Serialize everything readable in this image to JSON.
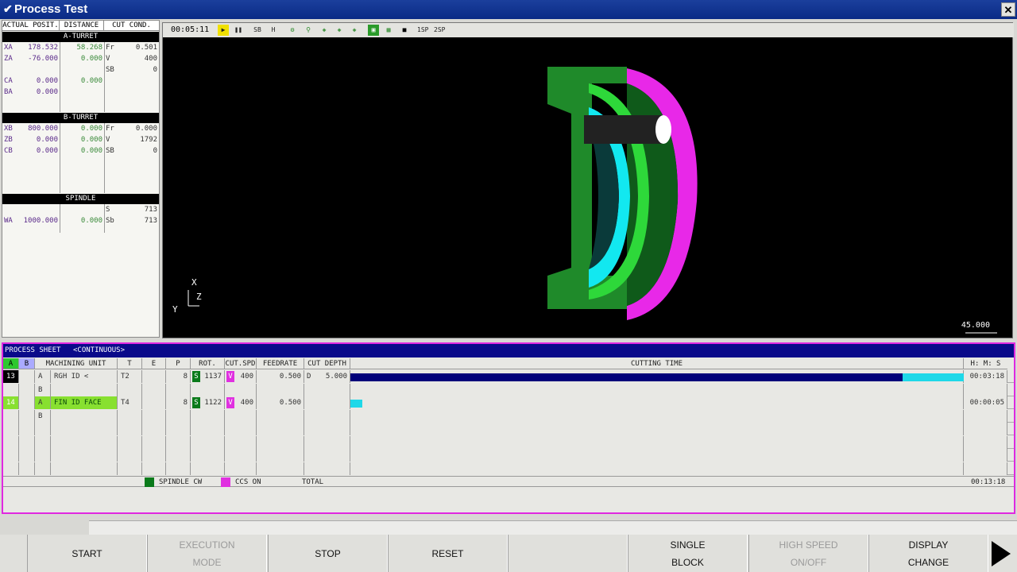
{
  "window": {
    "title": "Process Test",
    "close_label": "✕"
  },
  "left_panel": {
    "headers": [
      "ACTUAL POSIT.",
      "DISTANCE",
      "CUT COND."
    ],
    "a_turret": {
      "title": "A-TURRET",
      "rows": [
        {
          "axis": "XA",
          "pos": "178.532",
          "dist": "58.268",
          "cond": "Fr",
          "val": "0.501"
        },
        {
          "axis": "ZA",
          "pos": "-76.000",
          "dist": "0.000",
          "cond": "V",
          "val": "400"
        },
        {
          "axis": "",
          "pos": "",
          "dist": "",
          "cond": "SB",
          "val": "0"
        },
        {
          "axis": "CA",
          "pos": "0.000",
          "dist": "0.000",
          "cond": "",
          "val": ""
        },
        {
          "axis": "BA",
          "pos": "0.000",
          "dist": "",
          "cond": "",
          "val": ""
        }
      ]
    },
    "b_turret": {
      "title": "B-TURRET",
      "rows": [
        {
          "axis": "XB",
          "pos": "800.000",
          "dist": "0.000",
          "cond": "Fr",
          "val": "0.000"
        },
        {
          "axis": "ZB",
          "pos": "0.000",
          "dist": "0.000",
          "cond": "V",
          "val": "1792"
        },
        {
          "axis": "CB",
          "pos": "0.000",
          "dist": "0.000",
          "cond": "SB",
          "val": "0"
        }
      ]
    },
    "spindle": {
      "title": "SPINDLE",
      "rows": [
        {
          "axis": "",
          "pos": "",
          "dist": "",
          "cond": "S",
          "val": "713"
        },
        {
          "axis": "WA",
          "pos": "1000.000",
          "dist": "0.000",
          "cond": "Sb",
          "val": "713"
        }
      ]
    }
  },
  "graphic": {
    "time": "00:05:11",
    "scale": "45.000",
    "axis_x": "X",
    "axis_y": "Y",
    "axis_z": "Z",
    "toolbar": [
      "play-icon",
      "pause-icon",
      "sb-icon",
      "h-icon",
      "tool-icon",
      "probe-icon",
      "cube-icon",
      "cube2-icon",
      "cube3-icon",
      "view-icon",
      "grid-icon",
      "stop-icon",
      "1sp-icon",
      "2sp-icon"
    ],
    "toolbar_labels": {
      "sb": "SB",
      "h": "H",
      "sp1": "1SP",
      "sp2": "2SP"
    }
  },
  "process_sheet": {
    "title": "PROCESS SHEET",
    "mode": "<CONTINUOUS>",
    "col_a": "A",
    "col_b": "B",
    "columns": [
      "MACHINING UNIT",
      "T",
      "E",
      "P",
      "ROT.",
      "CUT.SPD",
      "FEEDRATE",
      "CUT DEPTH",
      "CUTTING TIME",
      "H: M: S"
    ],
    "rows": [
      {
        "no": "13",
        "turret": "A",
        "unit": "RGH ID <",
        "t": "T2",
        "e": "",
        "p": "8",
        "s": "S",
        "rot": "1137",
        "v": "V",
        "spd": "400",
        "feed": "0.500",
        "d": "D",
        "depth": "5.000",
        "time": "00:03:18",
        "progress": 0.9
      },
      {
        "no": "",
        "turret": "B",
        "unit": "",
        "t": "",
        "e": "",
        "p": "",
        "s": "",
        "rot": "",
        "v": "",
        "spd": "",
        "feed": "",
        "d": "",
        "depth": "",
        "time": "",
        "progress": 0
      },
      {
        "no": "14",
        "turret": "A",
        "unit": "FIN ID FACE",
        "t": "T4",
        "e": "",
        "p": "8",
        "s": "S",
        "rot": "1122",
        "v": "V",
        "spd": "400",
        "feed": "0.500",
        "d": "",
        "depth": "",
        "time": "00:00:05",
        "progress": 0.02
      },
      {
        "no": "",
        "turret": "B",
        "unit": "",
        "t": "",
        "e": "",
        "p": "",
        "s": "",
        "rot": "",
        "v": "",
        "spd": "",
        "feed": "",
        "d": "",
        "depth": "",
        "time": "",
        "progress": 0
      }
    ],
    "footer": {
      "spindle": "SPINDLE CW",
      "ccs": "CCS ON",
      "total": "TOTAL",
      "total_time": "00:13:18"
    }
  },
  "function_keys": [
    {
      "line1": "START",
      "line2": "",
      "enabled": true
    },
    {
      "line1": "EXECUTION",
      "line2": "MODE",
      "enabled": false
    },
    {
      "line1": "STOP",
      "line2": "",
      "enabled": true
    },
    {
      "line1": "RESET",
      "line2": "",
      "enabled": true
    },
    {
      "line1": "",
      "line2": "",
      "enabled": true
    },
    {
      "line1": "SINGLE",
      "line2": "BLOCK",
      "enabled": true
    },
    {
      "line1": "HIGH SPEED",
      "line2": "ON/OFF",
      "enabled": false
    },
    {
      "line1": "DISPLAY",
      "line2": "CHANGE",
      "enabled": true
    }
  ],
  "colors": {
    "progress_dark": "#00007a",
    "progress_light": "#1ed8e8",
    "spindle_green": "#0a7a1a",
    "ccs_magenta": "#e030e0",
    "highlight_green": "#88e030"
  }
}
